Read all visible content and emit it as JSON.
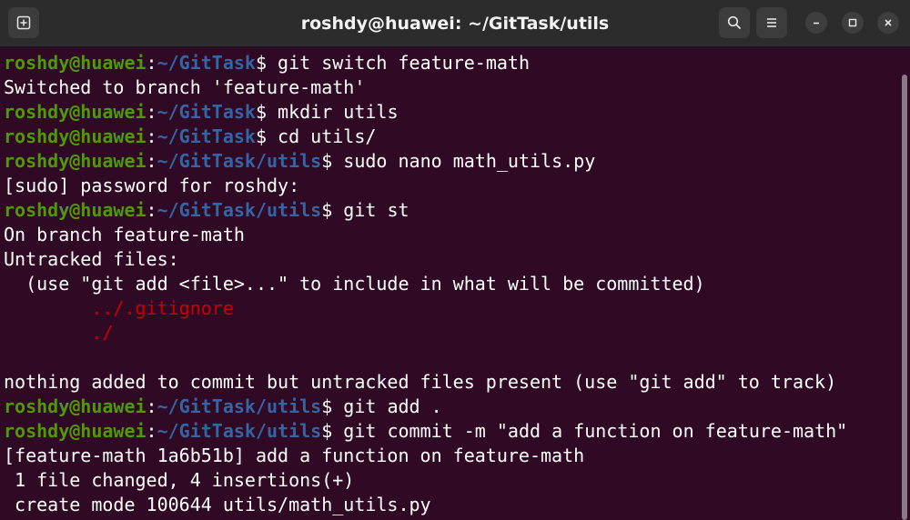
{
  "window": {
    "title": "roshdy@huawei: ~/GitTask/utils"
  },
  "titlebar_icons": {
    "new_tab": "new-tab-icon",
    "search": "search-icon",
    "menu": "hamburger-menu-icon",
    "minimize": "minimize-icon",
    "maximize": "maximize-icon",
    "close": "close-icon"
  },
  "colors": {
    "background": "#300a24",
    "prompt_user": "#4e9a06",
    "prompt_path": "#3465a4",
    "untracked": "#cc0000",
    "text": "#ffffff"
  },
  "terminal": {
    "lines": [
      {
        "user": "roshdy@huawei",
        "sep": ":",
        "path": "~/GitTask",
        "cmd": "$ git switch feature-math"
      },
      {
        "text": "Switched to branch 'feature-math'"
      },
      {
        "user": "roshdy@huawei",
        "sep": ":",
        "path": "~/GitTask",
        "cmd": "$ mkdir utils"
      },
      {
        "user": "roshdy@huawei",
        "sep": ":",
        "path": "~/GitTask",
        "cmd": "$ cd utils/"
      },
      {
        "user": "roshdy@huawei",
        "sep": ":",
        "path": "~/GitTask/utils",
        "cmd": "$ sudo nano math_utils.py"
      },
      {
        "text": "[sudo] password for roshdy:"
      },
      {
        "user": "roshdy@huawei",
        "sep": ":",
        "path": "~/GitTask/utils",
        "cmd": "$ git st"
      },
      {
        "text": "On branch feature-math"
      },
      {
        "text": "Untracked files:"
      },
      {
        "text": "  (use \"git add <file>...\" to include in what will be committed)"
      },
      {
        "untracked": "        ../.gitignore"
      },
      {
        "untracked": "        ./"
      },
      {
        "text": ""
      },
      {
        "text": "nothing added to commit but untracked files present (use \"git add\" to track)"
      },
      {
        "user": "roshdy@huawei",
        "sep": ":",
        "path": "~/GitTask/utils",
        "cmd": "$ git add ."
      },
      {
        "user": "roshdy@huawei",
        "sep": ":",
        "path": "~/GitTask/utils",
        "cmd": "$ git commit -m \"add a function on feature-math\""
      },
      {
        "text": "[feature-math 1a6b51b] add a function on feature-math"
      },
      {
        "text": " 1 file changed, 4 insertions(+)"
      },
      {
        "text": " create mode 100644 utils/math_utils.py"
      }
    ]
  }
}
